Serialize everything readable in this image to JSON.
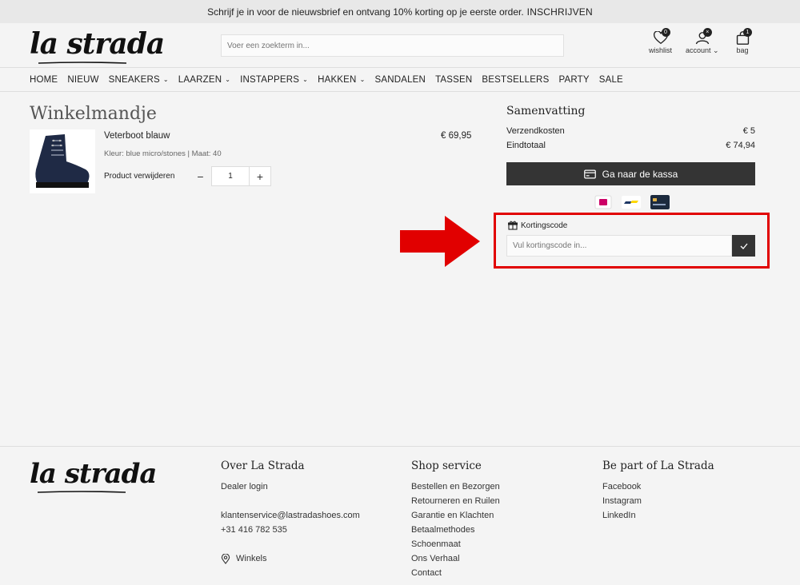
{
  "topbar": {
    "message": "Schrijf je in voor de nieuwsbrief en ontvang 10% korting op je eerste order.",
    "cta": "INSCHRIJVEN"
  },
  "header": {
    "logo": "la strada",
    "search_placeholder": "Voer een zoekterm in...",
    "wishlist": {
      "label": "wishlist",
      "count": "0"
    },
    "account": {
      "label": "account",
      "badge": "×"
    },
    "bag": {
      "label": "bag",
      "count": "1"
    }
  },
  "nav": {
    "items": [
      {
        "label": "HOME",
        "dropdown": false
      },
      {
        "label": "NIEUW",
        "dropdown": false
      },
      {
        "label": "SNEAKERS",
        "dropdown": true
      },
      {
        "label": "LAARZEN",
        "dropdown": true
      },
      {
        "label": "INSTAPPERS",
        "dropdown": true
      },
      {
        "label": "HAKKEN",
        "dropdown": true
      },
      {
        "label": "SANDALEN",
        "dropdown": false
      },
      {
        "label": "TASSEN",
        "dropdown": false
      },
      {
        "label": "BESTSELLERS",
        "dropdown": false
      },
      {
        "label": "PARTY",
        "dropdown": false
      },
      {
        "label": "SALE",
        "dropdown": false
      }
    ],
    "chevron": "⌄"
  },
  "cart": {
    "title": "Winkelmandje",
    "product": {
      "name": "Veterboot blauw",
      "meta": "Kleur: blue micro/stones | Maat: 40",
      "remove": "Product verwijderen",
      "quantity": "1",
      "minus": "−",
      "plus": "+",
      "price": "€ 69,95"
    }
  },
  "summary": {
    "title": "Samenvatting",
    "shipping_label": "Verzendkosten",
    "shipping_value": "€ 5",
    "total_label": "Eindtotaal",
    "total_value": "€ 74,94",
    "checkout_label": "Ga naar de kassa",
    "discount_label": "Kortingscode",
    "discount_placeholder": "Vul kortingscode in..."
  },
  "colors": {
    "highlight": "#e10000",
    "dark_button": "#343434",
    "ideal": "#cc0066",
    "bancontact": "#1e3764"
  },
  "footer": {
    "logo": "la strada",
    "col1": {
      "title": "Over La Strada",
      "dealer": "Dealer login",
      "email": "klantenservice@lastradashoes.com",
      "phone": "+31 416 782 535",
      "stores": "Winkels"
    },
    "col2": {
      "title": "Shop service",
      "links": [
        "Bestellen en Bezorgen",
        "Retourneren en Ruilen",
        "Garantie en Klachten",
        "Betaalmethodes",
        "Schoenmaat",
        "Ons Verhaal",
        "Contact"
      ]
    },
    "col3": {
      "title": "Be part of La Strada",
      "links": [
        "Facebook",
        "Instagram",
        "LinkedIn"
      ]
    }
  }
}
